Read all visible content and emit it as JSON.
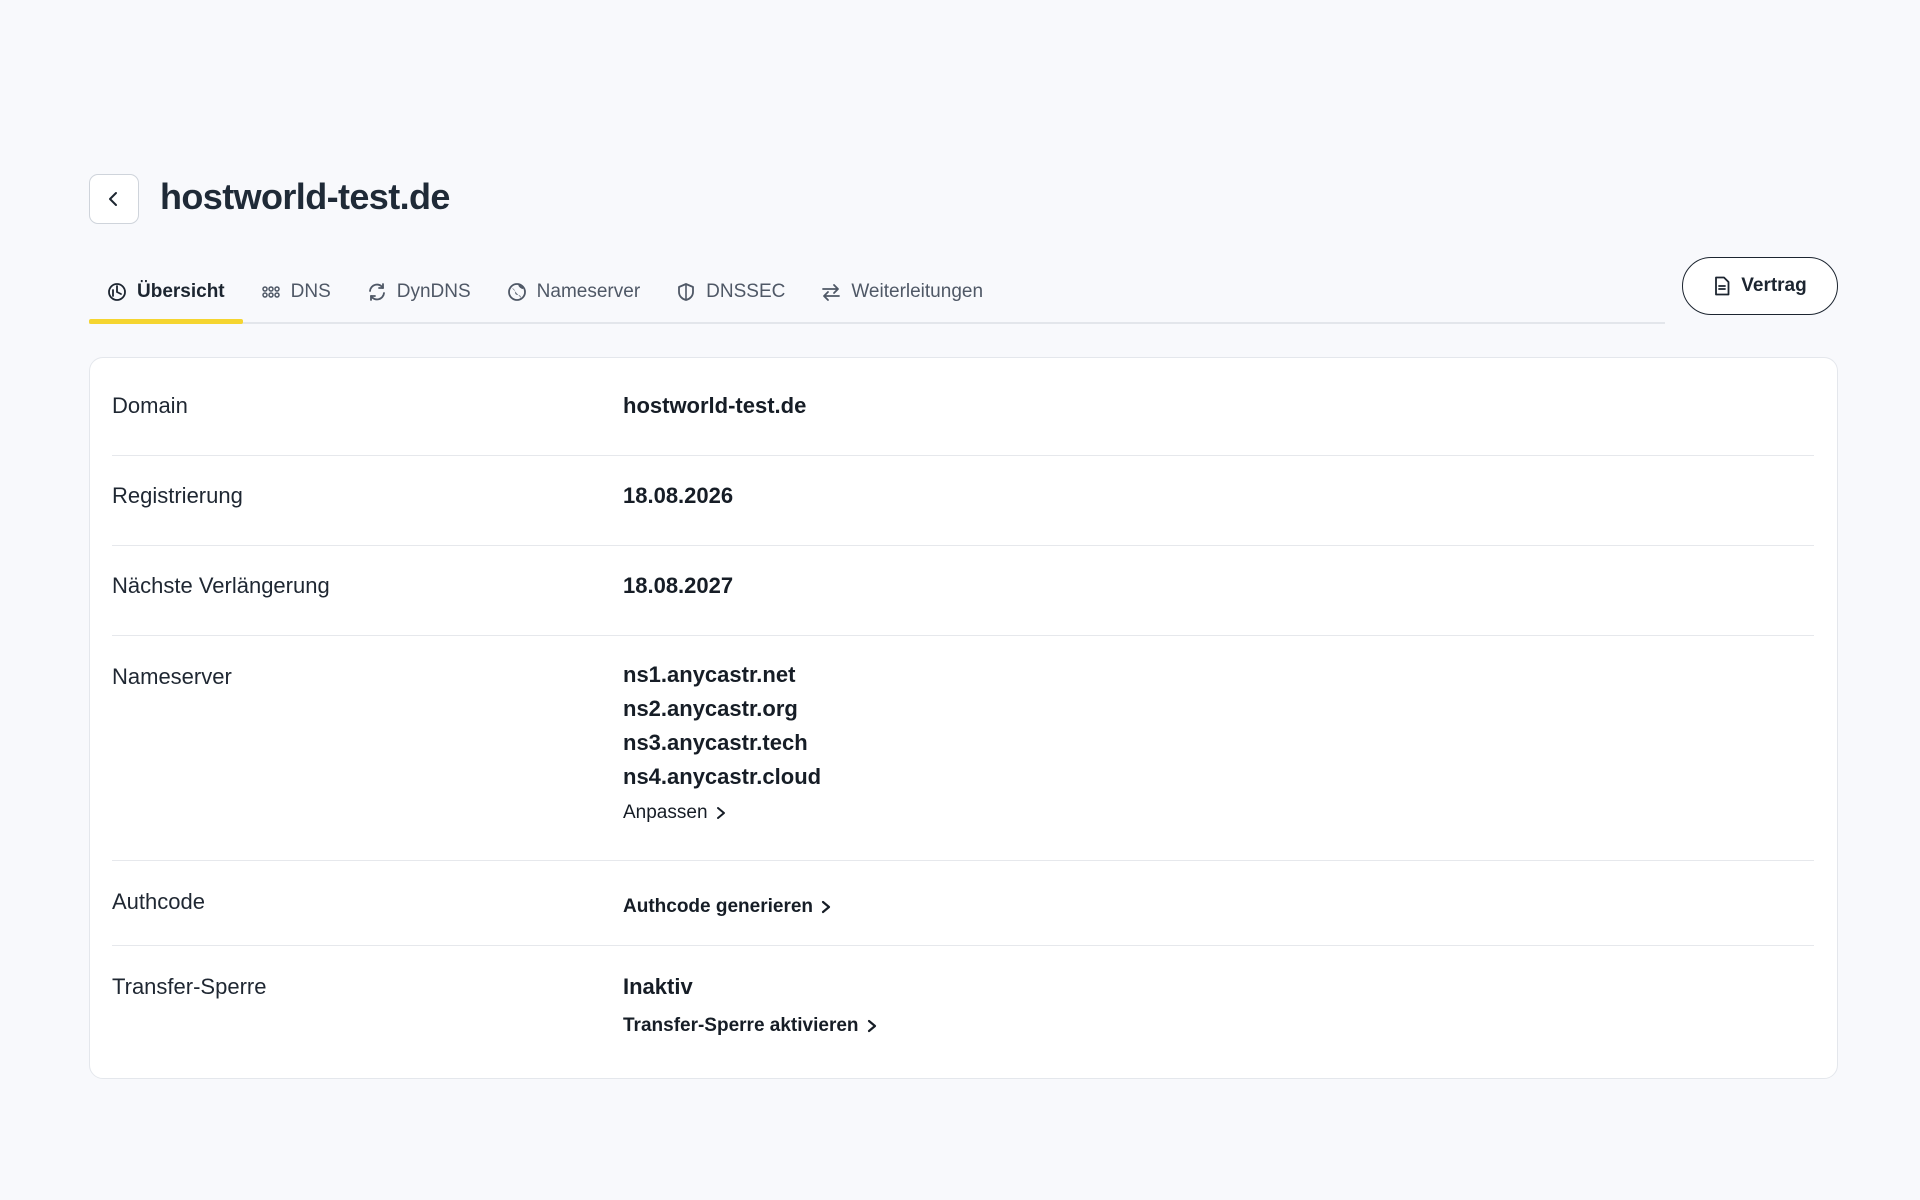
{
  "header": {
    "title": "hostworld-test.de",
    "back_icon": "chevron-left-icon"
  },
  "tabs": [
    {
      "label": "Übersicht",
      "icon": "dashboard-icon",
      "active": true
    },
    {
      "label": "DNS",
      "icon": "grid-dots-icon",
      "active": false
    },
    {
      "label": "DynDNS",
      "icon": "refresh-icon",
      "active": false
    },
    {
      "label": "Nameserver",
      "icon": "globe-icon",
      "active": false
    },
    {
      "label": "DNSSEC",
      "icon": "shield-icon",
      "active": false
    },
    {
      "label": "Weiterleitungen",
      "icon": "arrows-swap-icon",
      "active": false
    }
  ],
  "contract_button": {
    "label": "Vertrag",
    "icon": "document-icon"
  },
  "details": {
    "domain": {
      "label": "Domain",
      "value": "hostworld-test.de"
    },
    "registration": {
      "label": "Registrierung",
      "value": "18.08.2026"
    },
    "renewal": {
      "label": "Nächste Verlängerung",
      "value": "18.08.2027"
    },
    "nameserver": {
      "label": "Nameserver",
      "values": [
        "ns1.anycastr.net",
        "ns2.anycastr.org",
        "ns3.anycastr.tech",
        "ns4.anycastr.cloud"
      ],
      "link": "Anpassen"
    },
    "authcode": {
      "label": "Authcode",
      "link": "Authcode generieren"
    },
    "transfer_lock": {
      "label": "Transfer-Sperre",
      "value": "Inaktiv",
      "link": "Transfer-Sperre aktivieren"
    }
  },
  "colors": {
    "accent": "#f5d530",
    "background": "#f8f9fc",
    "text": "#1c2530"
  }
}
